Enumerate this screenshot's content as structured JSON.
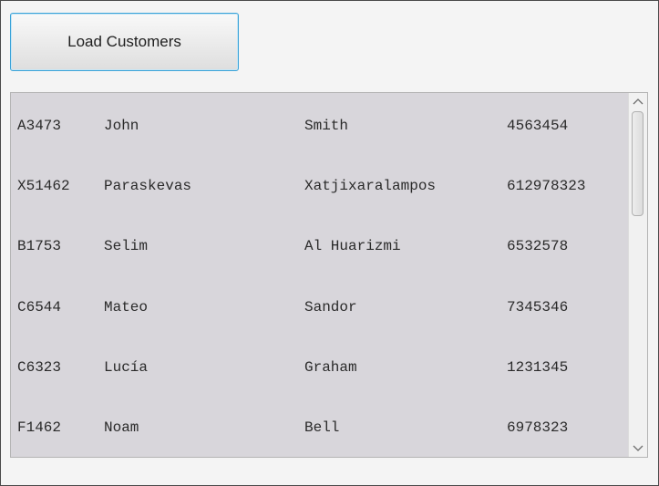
{
  "load_button": {
    "label": "Load Customers"
  },
  "scrollbar": {
    "up_icon": "chevron-up-icon",
    "down_icon": "chevron-down-icon",
    "position": 0.0
  },
  "customers": [
    {
      "id": "A3473",
      "first": "John",
      "last": "Smith",
      "phone": "4563454"
    },
    {
      "id": "X51462",
      "first": "Paraskevas",
      "last": "Xatjixaralampos",
      "phone": "612978323"
    },
    {
      "id": "B1753",
      "first": "Selim",
      "last": "Al Huarizmi",
      "phone": "6532578"
    },
    {
      "id": "C6544",
      "first": "Mateo",
      "last": "Sandor",
      "phone": "7345346"
    },
    {
      "id": "C6323",
      "first": "Lucía",
      "last": "Graham",
      "phone": "1231345"
    },
    {
      "id": "F1462",
      "first": "Noam",
      "last": "Bell",
      "phone": "6978323"
    }
  ],
  "colors": {
    "button_focus_border": "#3aa3d8",
    "list_background": "#d8d6db",
    "window_background": "#f4f4f4"
  }
}
